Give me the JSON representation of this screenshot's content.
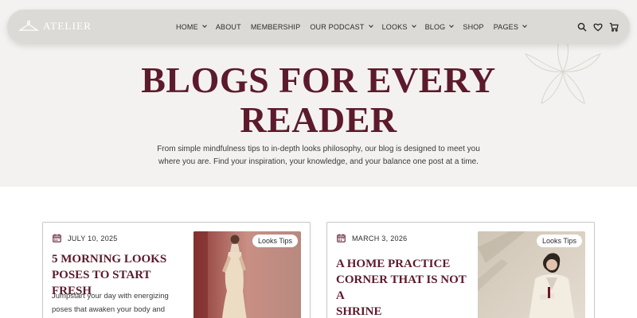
{
  "brand": {
    "name": "ATELIER"
  },
  "nav": {
    "items": [
      {
        "label": "HOME",
        "dropdown": true
      },
      {
        "label": "ABOUT",
        "dropdown": false
      },
      {
        "label": "MEMBERSHIP",
        "dropdown": false
      },
      {
        "label": "OUR PODCAST",
        "dropdown": true
      },
      {
        "label": "LOOKS",
        "dropdown": true
      },
      {
        "label": "BLOG",
        "dropdown": true
      },
      {
        "label": "SHOP",
        "dropdown": false
      },
      {
        "label": "PAGES",
        "dropdown": true
      }
    ],
    "icons": [
      "search-icon",
      "heart-icon",
      "cart-icon"
    ]
  },
  "hero": {
    "title_line1": "BLOGS FOR EVERY",
    "title_line2": "READER",
    "subtitle_line1": "From simple mindfulness tips to in-depth looks philosophy, our blog is designed to meet you",
    "subtitle_line2": "where you are. Find your inspiration, your knowledge, and your balance one post at a time."
  },
  "posts": [
    {
      "date": "JULY 10, 2025",
      "title_line1": "5 MORNING LOOKS",
      "title_line2": "POSES TO START FRESH",
      "excerpt_line1": "Jumpstart your day with energizing",
      "excerpt_line2": "poses that awaken your body and",
      "tag": "Looks Tips"
    },
    {
      "date": "MARCH 3, 2026",
      "title_line1": "A HOME PRACTICE",
      "title_line2": "CORNER THAT IS NOT A",
      "title_line3": "SHRINE",
      "tag": "Looks Tips"
    }
  ],
  "colors": {
    "accent": "#5c1a2c",
    "navbar": "#dcdad7",
    "hero_bg": "#f4f2f0"
  }
}
